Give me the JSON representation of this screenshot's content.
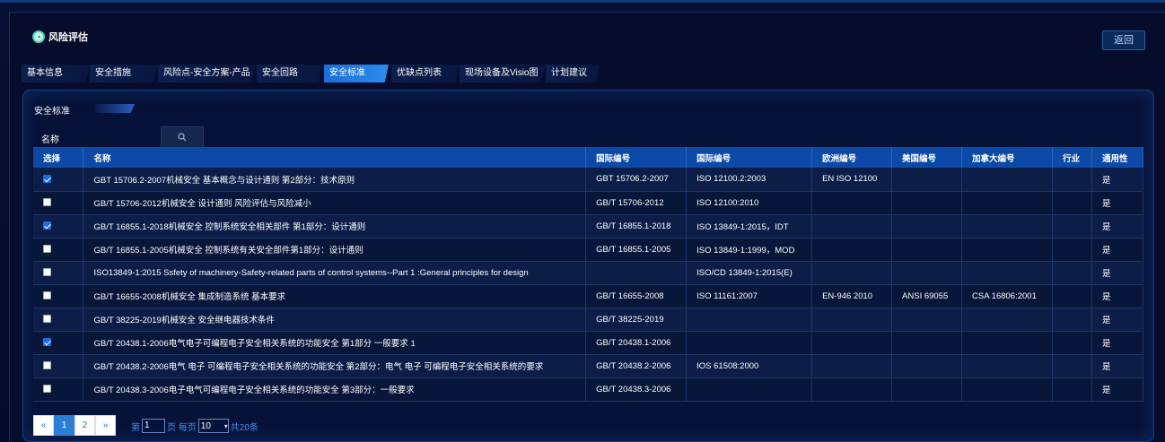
{
  "header": {
    "title": "风险评估",
    "back_label": "返回"
  },
  "tabs": [
    {
      "label": "基本信息",
      "active": false
    },
    {
      "label": "安全措施",
      "active": false
    },
    {
      "label": "风险点-安全方案-产品",
      "active": false
    },
    {
      "label": "安全回路",
      "active": false
    },
    {
      "label": "安全标准",
      "active": true
    },
    {
      "label": "优缺点列表",
      "active": false
    },
    {
      "label": "现场设备及Visio图",
      "active": false
    },
    {
      "label": "计划建议",
      "active": false
    }
  ],
  "panel": {
    "title": "安全标准"
  },
  "search": {
    "label": "名称",
    "value": "",
    "placeholder": ""
  },
  "table": {
    "headers": [
      "选择",
      "名称",
      "国际编号",
      "国际编号",
      "欧洲编号",
      "美国编号",
      "加拿大编号",
      "行业",
      "通用性"
    ],
    "rows": [
      {
        "checked": true,
        "name": "GBT 15706.2-2007机械安全 基本概念与设计通则 第2部分：技术原则",
        "intl1": "GBT 15706.2-2007",
        "intl2": "ISO 12100.2:2003",
        "eu": "EN ISO 12100",
        "us": "",
        "ca": "",
        "industry": "",
        "general": "是"
      },
      {
        "checked": false,
        "name": "GB/T 15706-2012机械安全 设计通则 风险评估与风险减小",
        "intl1": "GB/T 15706-2012",
        "intl2": "ISO 12100:2010",
        "eu": "",
        "us": "",
        "ca": "",
        "industry": "",
        "general": "是"
      },
      {
        "checked": true,
        "name": "GB/T 16855.1-2018机械安全 控制系统安全相关部件 第1部分：设计通则",
        "intl1": "GB/T 16855.1-2018",
        "intl2": "ISO 13849-1:2015，IDT",
        "eu": "",
        "us": "",
        "ca": "",
        "industry": "",
        "general": "是"
      },
      {
        "checked": false,
        "name": "GB/T 16855.1-2005机械安全 控制系统有关安全部件第1部分：设计通则",
        "intl1": "GB/T 16855.1-2005",
        "intl2": "ISO 13849-1:1999，MOD",
        "eu": "",
        "us": "",
        "ca": "",
        "industry": "",
        "general": "是"
      },
      {
        "checked": false,
        "name": "ISO13849-1:2015 Ssfety of machinery-Safety-related parts of control systems--Part 1 :General principles for design",
        "intl1": "",
        "intl2": "ISO/CD 13849-1:2015(E)",
        "eu": "",
        "us": "",
        "ca": "",
        "industry": "",
        "general": "是"
      },
      {
        "checked": false,
        "name": "GB/T 16655-2008机械安全 集成制造系统 基本要求",
        "intl1": "GB/T 16655-2008",
        "intl2": "ISO 11161:2007",
        "eu": "EN-946 2010",
        "us": "ANSI 69055",
        "ca": "CSA 16806:2001",
        "industry": "",
        "general": "是"
      },
      {
        "checked": false,
        "name": "GB/T 38225-2019机械安全 安全继电器技术条件",
        "intl1": "GB/T 38225-2019",
        "intl2": "",
        "eu": "",
        "us": "",
        "ca": "",
        "industry": "",
        "general": "是"
      },
      {
        "checked": true,
        "name": "GB/T 20438.1-2006电气电子可编程电子安全相关系统的功能安全 第1部分 一般要求 1",
        "intl1": "GB/T 20438.1-2006",
        "intl2": "",
        "eu": "",
        "us": "",
        "ca": "",
        "industry": "",
        "general": "是"
      },
      {
        "checked": false,
        "name": "GB/T 20438.2-2006电气 电子 可编程电子安全相关系统的功能安全 第2部分：电气 电子 可编程电子安全相关系统的要求",
        "intl1": "GB/T 20438.2-2006",
        "intl2": "IOS 61508:2000",
        "eu": "",
        "us": "",
        "ca": "",
        "industry": "",
        "general": "是"
      },
      {
        "checked": false,
        "name": "GB/T 20438.3-2006电子电气可编程电子安全相关系统的功能安全 第3部分：一般要求",
        "intl1": "GB/T 20438.3-2006",
        "intl2": "",
        "eu": "",
        "us": "",
        "ca": "",
        "industry": "",
        "general": "是"
      }
    ]
  },
  "pagination": {
    "prev": "«",
    "pages": [
      "1",
      "2"
    ],
    "current": "1",
    "next": "»",
    "page_prefix": "第",
    "page_value": "1",
    "page_suffix": "页 每页",
    "page_size": "10",
    "total_text": "共20条"
  }
}
